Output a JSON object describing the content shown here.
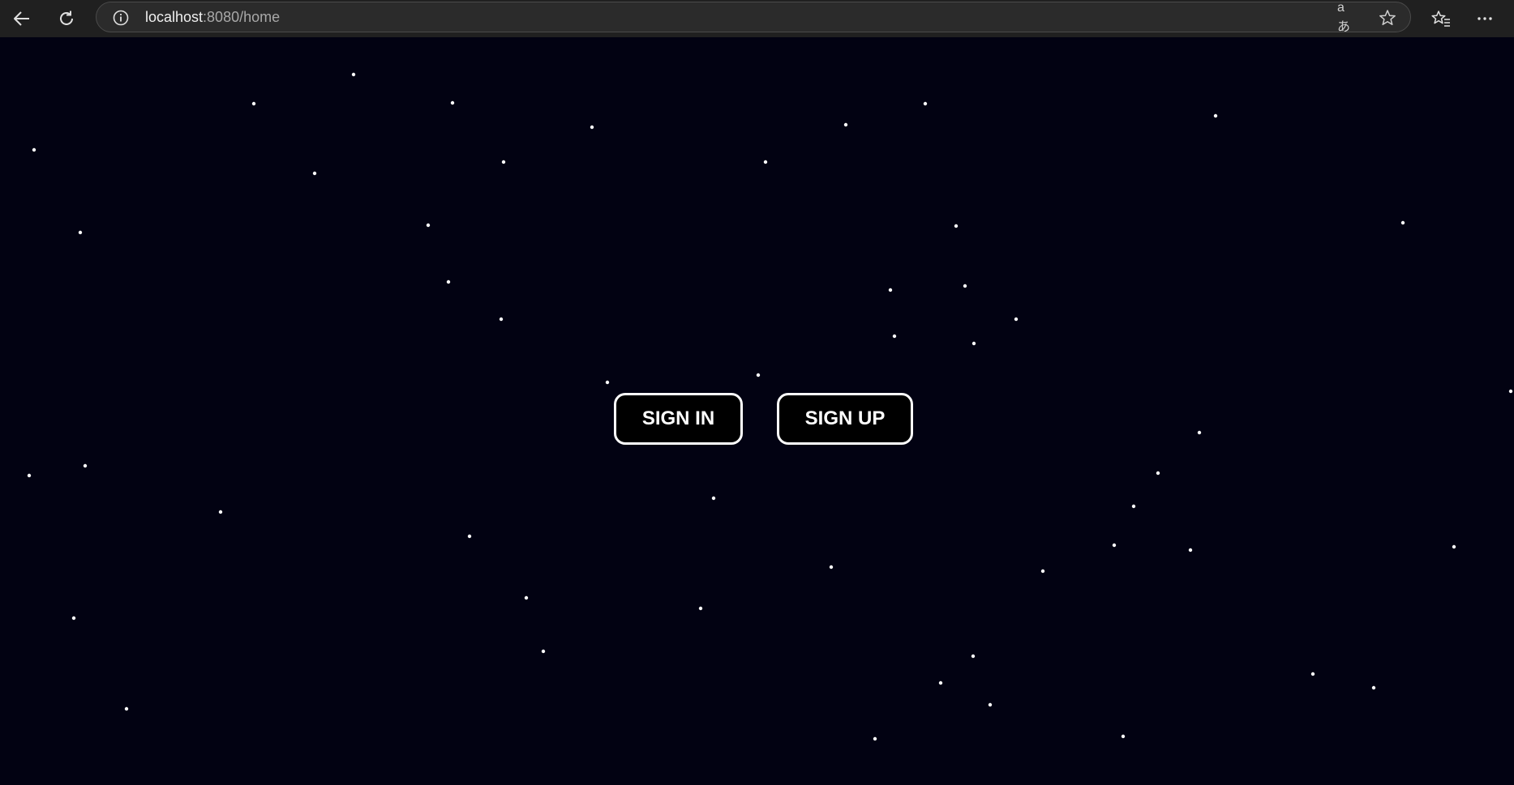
{
  "browser": {
    "url_host": "localhost",
    "url_rest": ":8080/home",
    "read_aloud_glyph": "aあ",
    "icons": [
      "back-arrow-icon",
      "refresh-icon",
      "info-icon",
      "read-aloud-icon",
      "star-icon",
      "favorites-icon",
      "more-icon"
    ]
  },
  "page": {
    "background_color": "#020212",
    "star_color": "#ffffff",
    "sign_in_label": "SIGN IN",
    "sign_up_label": "SIGN UP"
  }
}
